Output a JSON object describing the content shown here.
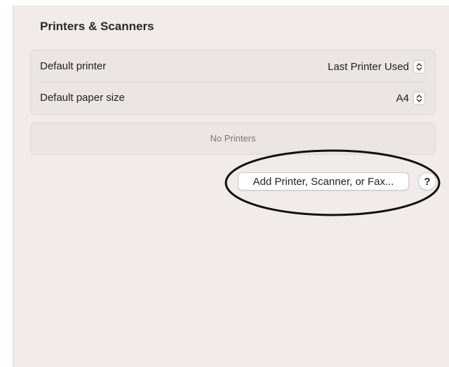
{
  "page": {
    "title": "Printers & Scanners"
  },
  "settings": {
    "rows": [
      {
        "label": "Default printer",
        "value": "Last Printer Used"
      },
      {
        "label": "Default paper size",
        "value": "A4"
      }
    ]
  },
  "printers": {
    "empty_label": "No Printers"
  },
  "actions": {
    "add_label": "Add Printer, Scanner, or Fax...",
    "help_label": "?"
  },
  "icons": {
    "popup_stepper": "chevron-up-down-icon"
  },
  "colors": {
    "window_background": "#f1ebe9",
    "group_background": "#ebe5e3",
    "annotation_stroke": "#111111"
  }
}
